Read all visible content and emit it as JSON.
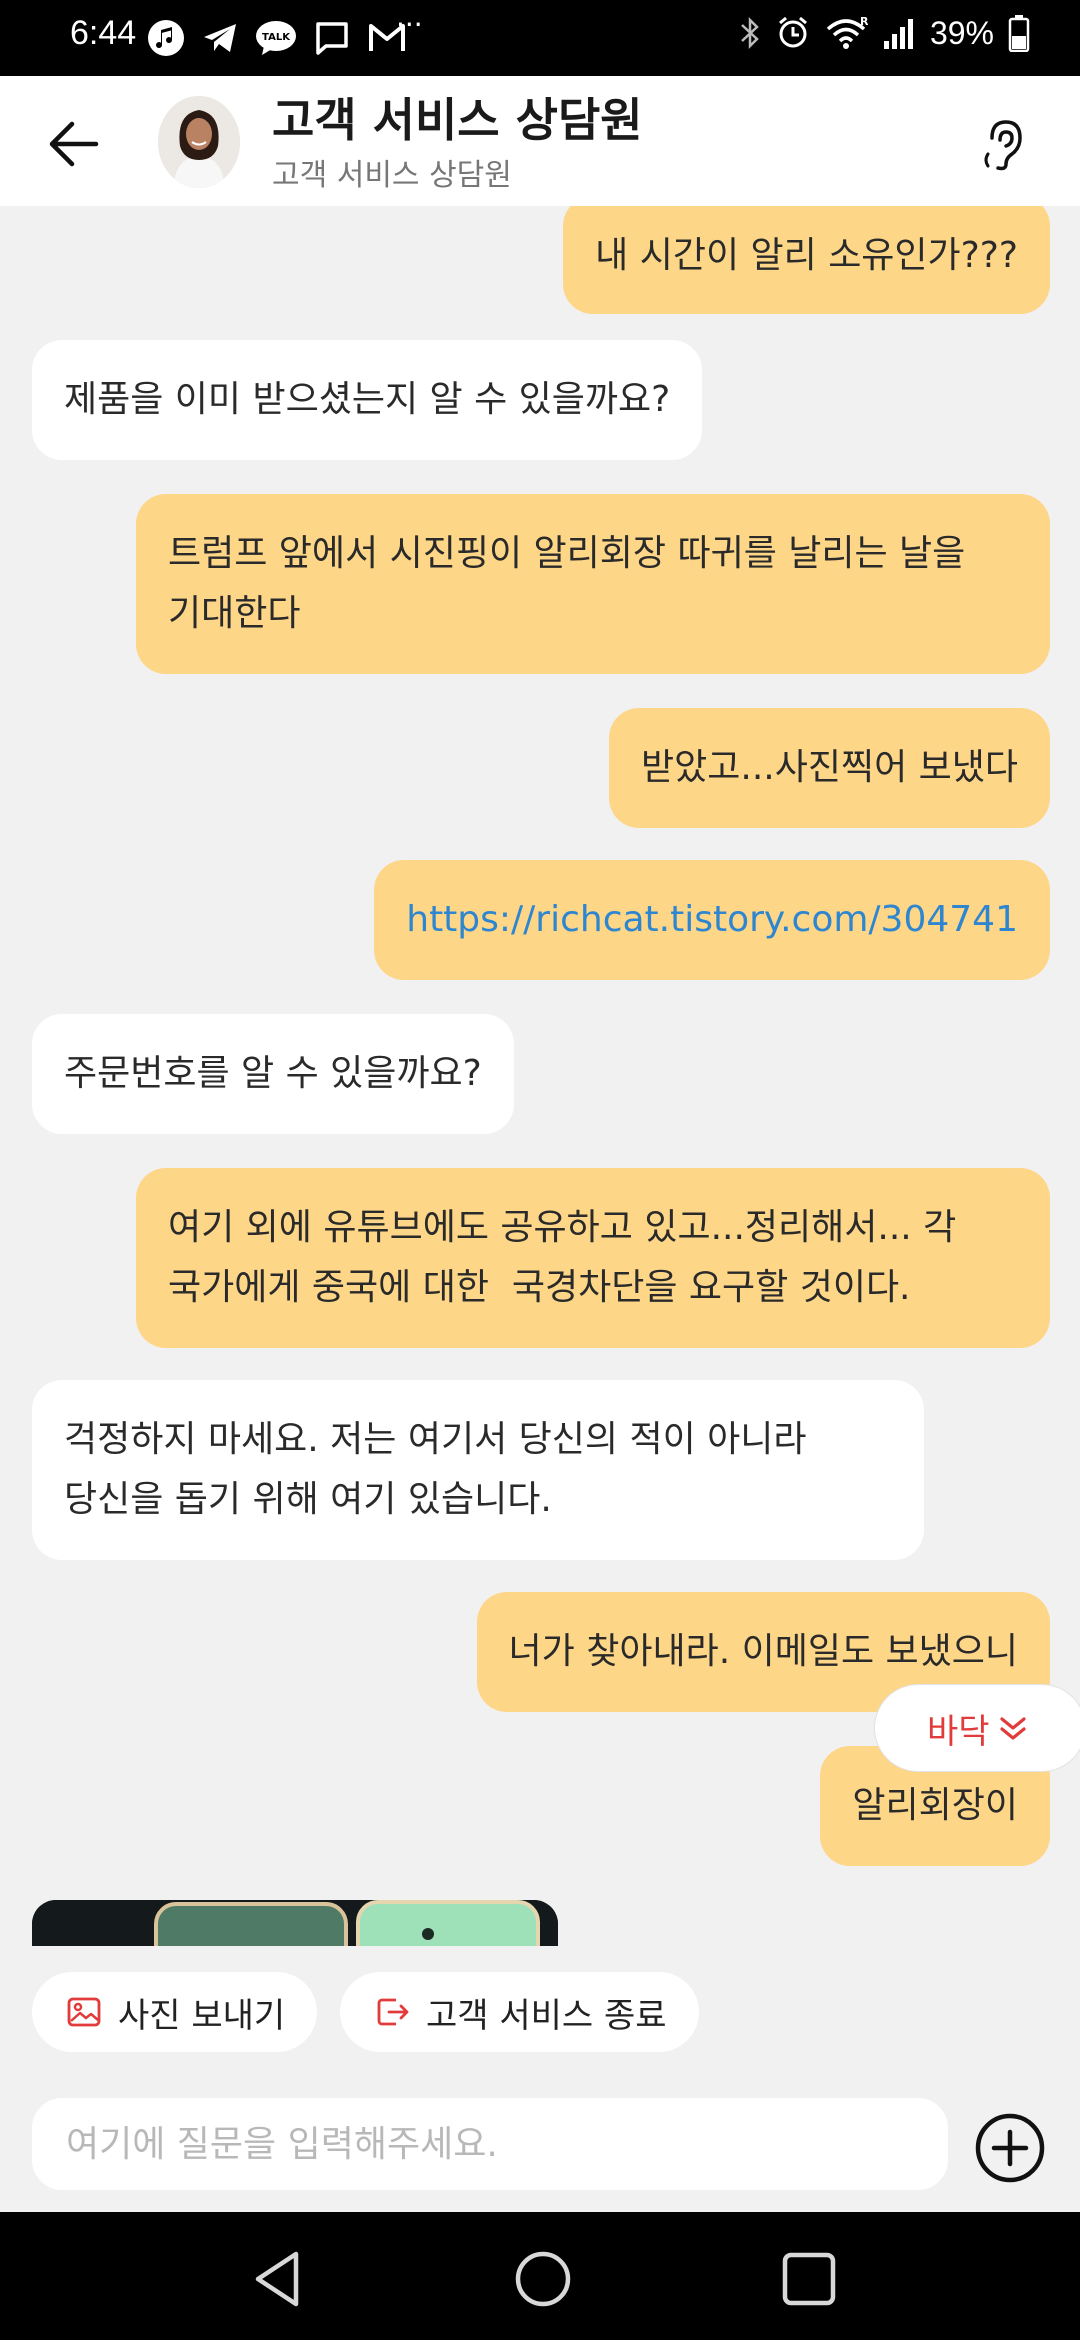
{
  "status_bar": {
    "time": "6:44",
    "battery": "39%",
    "left_icons": [
      "music-icon",
      "telegram-icon",
      "talk-icon",
      "message-icon",
      "gmail-icon",
      "more-icon"
    ],
    "right_icons": [
      "bluetooth-icon",
      "alarm-icon",
      "wifi-icon",
      "signal-icon",
      "battery-icon"
    ]
  },
  "header": {
    "title": "고객 서비스 상담원",
    "subtitle": "고객 서비스 상담원",
    "back_icon": "arrow-left-icon",
    "right_icon": "ear-icon"
  },
  "messages": [
    {
      "from": "user",
      "text": "내 시간이 알리 소유인가???"
    },
    {
      "from": "agent",
      "text": "제품을 이미 받으셨는지 알 수 있을까요?"
    },
    {
      "from": "user",
      "text": "트럼프 앞에서 시진핑이 알리회장 따귀를 날리는 날을\n기대한다"
    },
    {
      "from": "user",
      "text": "받았고...사진찍어 보냈다"
    },
    {
      "from": "user",
      "text": "https://richcat.tistory.com/304741",
      "is_link": true
    },
    {
      "from": "agent",
      "text": "주문번호를 알 수 있을까요?"
    },
    {
      "from": "user",
      "text": "여기 외에 유튜브에도 공유하고 있고...정리해서... 각\n국가에게 중국에 대한  국경차단을 요구할 것이다."
    },
    {
      "from": "agent",
      "text": "걱정하지 마세요. 저는 여기서 당신의 적이 아니라\n당신을 돕기 위해 여기 있습니다."
    },
    {
      "from": "user",
      "text": "너가 찾아내라. 이메일도 보냈으니"
    },
    {
      "from": "user",
      "text": "알리회장이"
    }
  ],
  "scroll_bottom": {
    "label": "바닥",
    "icon": "double-chevron-down-icon"
  },
  "quick_actions": [
    {
      "label": "사진 보내기",
      "icon": "image-icon"
    },
    {
      "label": "고객 서비스 종료",
      "icon": "exit-icon"
    }
  ],
  "input": {
    "placeholder": "여기에 질문을 입력해주세요.",
    "value": ""
  },
  "colors": {
    "user_bubble": "#fdd688",
    "agent_bubble": "#ffffff",
    "link": "#2e86d1",
    "accent_red": "#e23b3b"
  }
}
